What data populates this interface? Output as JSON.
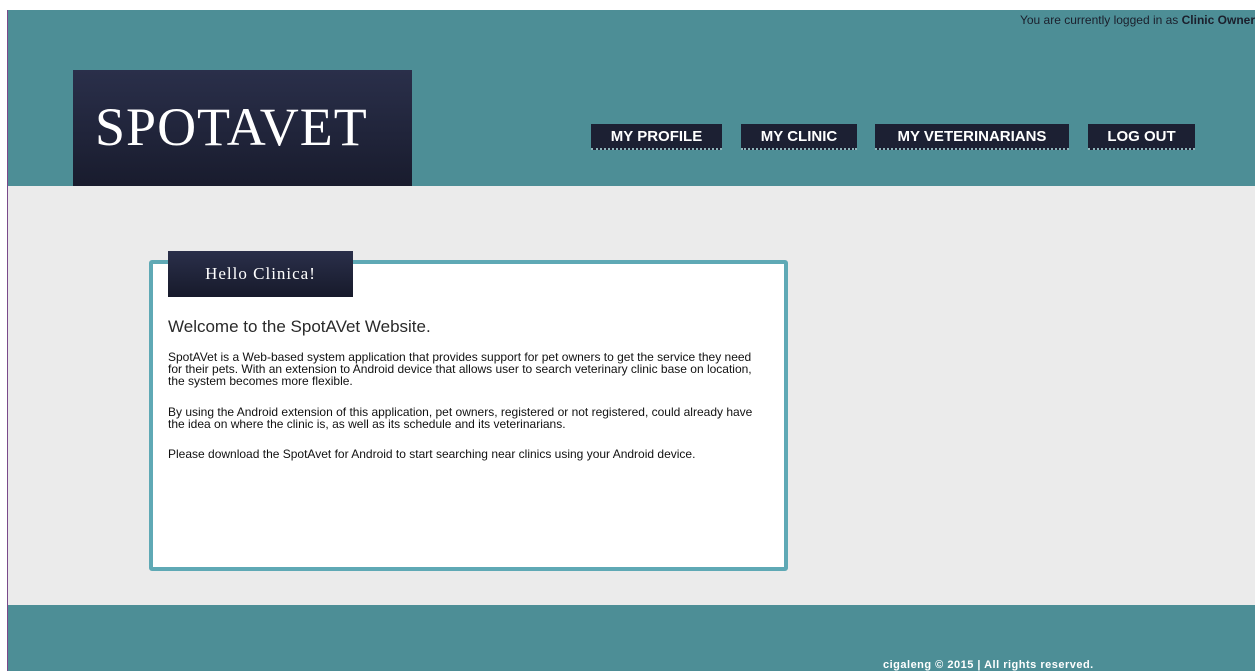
{
  "header": {
    "login_status_prefix": "You are currently logged in as ",
    "login_role": "Clinic Owner",
    "logo_text": "SPOTAVET"
  },
  "nav": {
    "items": [
      {
        "label": "MY PROFILE"
      },
      {
        "label": "MY CLINIC"
      },
      {
        "label": "MY VETERINARIANS"
      },
      {
        "label": "LOG OUT"
      }
    ]
  },
  "main": {
    "greeting": "Hello Clinica!",
    "heading": "Welcome to the SpotAVet Website.",
    "paragraphs": [
      "SpotAVet is a Web-based system application that provides support for pet owners to get the service they need for their pets. With an extension to Android device that allows user to search veterinary clinic base on location, the system becomes more flexible.",
      "By using the Android extension of this application, pet owners, registered or not registered, could already have the idea on where the clinic is, as well as its schedule and its veterinarians.",
      "Please download the SpotAvet for Android to start searching near clinics using your Android device."
    ]
  },
  "footer": {
    "copyright": "cigaleng © 2015 | All rights reserved."
  },
  "colors": {
    "header_bg": "#4d8e96",
    "main_bg": "#ebebeb",
    "dark_navy": "#1c2033",
    "content_border": "#5fa9b5"
  }
}
